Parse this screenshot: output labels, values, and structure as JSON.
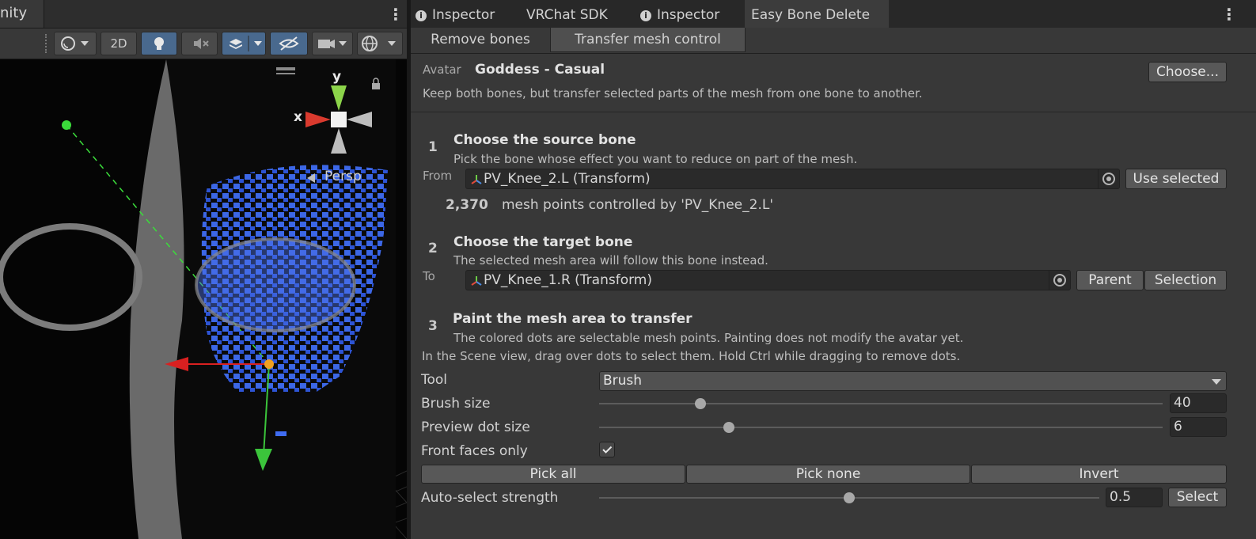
{
  "scene": {
    "tab_title": "nity",
    "toolbar": {
      "mode_2d": "2D"
    },
    "gizmo": {
      "y": "y",
      "x": "x",
      "persp": "Persp"
    }
  },
  "inspector": {
    "tabs": [
      {
        "label": "Inspector",
        "icon": "info-icon"
      },
      {
        "label": "VRChat SDK"
      },
      {
        "label": "Inspector",
        "icon": "info-icon"
      },
      {
        "label": "Easy Bone Delete",
        "active": true
      }
    ],
    "subtabs": [
      {
        "label": "Remove bones"
      },
      {
        "label": "Transfer mesh control",
        "active": true
      }
    ],
    "avatar": {
      "label": "Avatar",
      "name": "Goddess - Casual",
      "choose_button": "Choose...",
      "description": "Keep both bones, but transfer selected parts of the mesh from one bone to another."
    },
    "step1": {
      "number": "1",
      "title": "Choose the source bone",
      "description": "Pick the bone whose effect you want to reduce on part of the mesh.",
      "from_label": "From",
      "field_value": "PV_Knee_2.L (Transform)",
      "use_selected_button": "Use selected",
      "count": "2,370",
      "count_text": "mesh points controlled by 'PV_Knee_2.L'"
    },
    "step2": {
      "number": "2",
      "title": "Choose the target bone",
      "description": "The selected mesh area will follow this bone instead.",
      "to_label": "To",
      "field_value": "PV_Knee_1.R (Transform)",
      "parent_button": "Parent",
      "selection_button": "Selection"
    },
    "step3": {
      "number": "3",
      "title": "Paint the mesh area to transfer",
      "description": "The colored dots are selectable mesh points. Painting does not modify the avatar yet.",
      "instructions": "In the Scene view, drag over dots to select them. Hold Ctrl while dragging to remove dots.",
      "tool_label": "Tool",
      "tool_value": "Brush",
      "brush_size_label": "Brush size",
      "brush_size_value": "40",
      "brush_size_fraction": 0.18,
      "dot_size_label": "Preview dot size",
      "dot_size_value": "6",
      "dot_size_fraction": 0.23,
      "front_faces_label": "Front faces only",
      "front_faces_checked": true,
      "pick_all": "Pick all",
      "pick_none": "Pick none",
      "invert": "Invert",
      "auto_select_label": "Auto-select strength",
      "auto_select_value": "0.5",
      "auto_select_fraction": 0.5,
      "select_button": "Select"
    }
  }
}
